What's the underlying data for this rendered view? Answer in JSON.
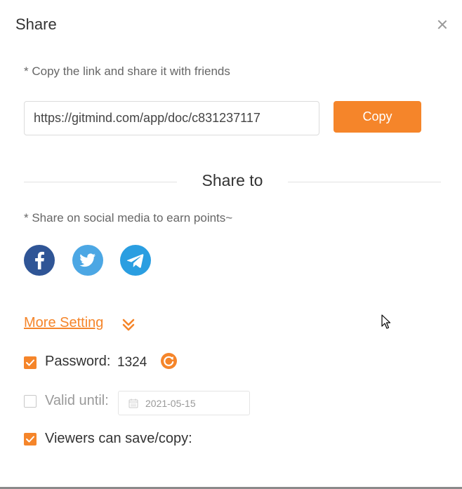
{
  "dialog": {
    "title": "Share"
  },
  "copy_section": {
    "hint": "* Copy the link and share it with friends",
    "link_value": "https://gitmind.com/app/doc/c831237117",
    "copy_label": "Copy"
  },
  "share_section": {
    "heading": "Share to",
    "hint": "* Share on social media to earn points~",
    "networks": [
      "facebook-icon",
      "twitter-icon",
      "telegram-icon"
    ]
  },
  "settings": {
    "more_label": "More Setting",
    "password": {
      "checked": true,
      "label": "Password:",
      "value": "1324"
    },
    "valid_until": {
      "checked": false,
      "label": "Valid until:",
      "date": "2021-05-15"
    },
    "viewers_save": {
      "checked": true,
      "label": "Viewers can save/copy:"
    }
  },
  "colors": {
    "accent": "#f5852a",
    "facebook": "#2f5596",
    "twitter": "#4ca7e4",
    "telegram": "#2a9ee1"
  }
}
